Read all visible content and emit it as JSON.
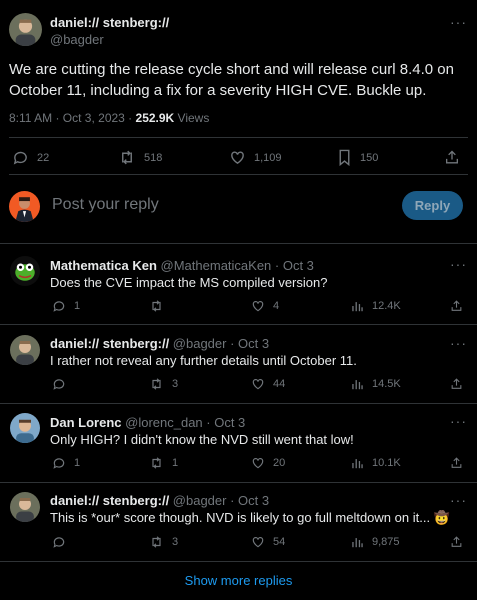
{
  "main_tweet": {
    "author_name": "daniel:// stenberg://",
    "author_handle": "@bagder",
    "text_line1": "We are cutting the release cycle short and will release curl 8.4.0 on",
    "text_line2": "October 11, including a fix for a severity HIGH CVE. Buckle up.",
    "timestamp": "8:11 AM · Oct 3, 2023 · ",
    "views_count": "252.9K",
    "views_label": " Views",
    "replies": "22",
    "retweets": "518",
    "likes": "1,109",
    "bookmarks": "150"
  },
  "composer": {
    "placeholder": "Post your reply",
    "reply_button": "Reply"
  },
  "replies": [
    {
      "name": "Mathematica Ken",
      "handle_time": " @MathematicaKen · Oct 3",
      "text": "Does the CVE impact the MS compiled version?",
      "replies": "1",
      "retweets": "",
      "likes": "4",
      "views": "12.4K"
    },
    {
      "name": "daniel:// stenberg://",
      "handle_time": " @bagder · Oct 3",
      "text": "I rather not reveal any further details until October 11.",
      "replies": "",
      "retweets": "3",
      "likes": "44",
      "views": "14.5K"
    },
    {
      "name": "Dan Lorenc",
      "handle_time": " @lorenc_dan · Oct 3",
      "text": "Only HIGH? I didn't know the NVD still went that low!",
      "replies": "1",
      "retweets": "1",
      "likes": "20",
      "views": "10.1K"
    },
    {
      "name": "daniel:// stenberg://",
      "handle_time": " @bagder · Oct 3",
      "text": "This is *our* score though. NVD is likely to go full meltdown on it... 🤠",
      "replies": "",
      "retweets": "3",
      "likes": "54",
      "views": "9,875"
    }
  ],
  "show_more": "Show more replies",
  "colors": {
    "background": "#000000",
    "text": "#e7e9ea",
    "muted": "#71767b",
    "accent": "#1d9bf0",
    "reply_button_bg": "#1a5a86",
    "divider": "#2f3336"
  }
}
